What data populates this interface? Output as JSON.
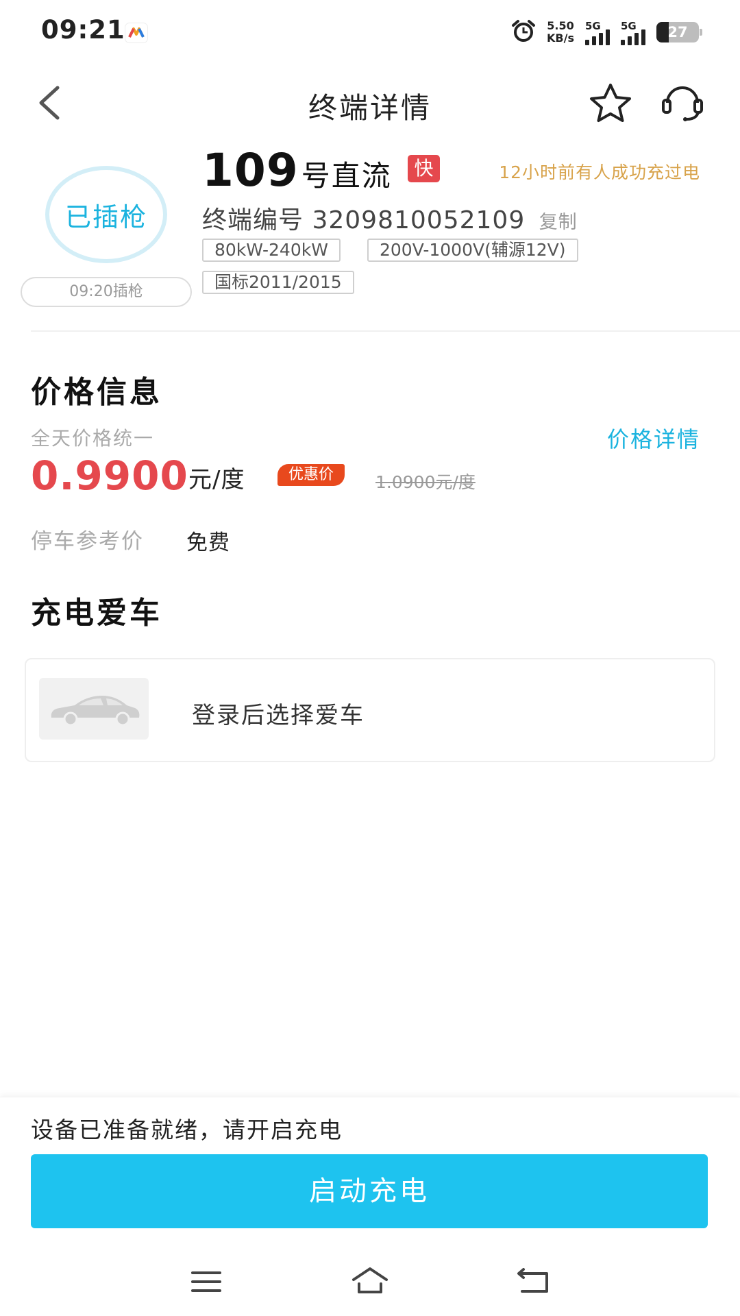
{
  "status_bar": {
    "time": "09:21",
    "speed_value": "5.50",
    "speed_unit": "KB/s",
    "signal1_label": "5G",
    "signal2_label": "5G",
    "battery": "27"
  },
  "header": {
    "title": "终端详情"
  },
  "terminal": {
    "plug_status": "已插枪",
    "plug_time": "09:20插枪",
    "number": "109",
    "type": "号直流",
    "fast_badge": "快",
    "recent_charge": "12小时前有人成功充过电",
    "id_label": "终端编号",
    "id_value": "3209810052109",
    "copy_label": "复制",
    "tags": {
      "power": "80kW-240kW",
      "voltage": "200V-1000V(辅源12V)",
      "standard": "国标2011/2015"
    }
  },
  "price": {
    "section_title": "价格信息",
    "subtitle": "全天价格统一",
    "detail_link": "价格详情",
    "value": "0.9900",
    "unit": "元/度",
    "discount_badge": "优惠价",
    "old_price": "1.0900元/度",
    "parking_label": "停车参考价",
    "parking_value": "免费"
  },
  "car": {
    "section_title": "充电爱车",
    "card_text": "登录后选择爱车"
  },
  "bottom": {
    "ready_text": "设备已准备就绪，请开启充电",
    "start_button": "启动充电"
  },
  "colors": {
    "accent": "#1ec3ef",
    "price_red": "#e5484d",
    "recent_gold": "#d8a34b"
  }
}
